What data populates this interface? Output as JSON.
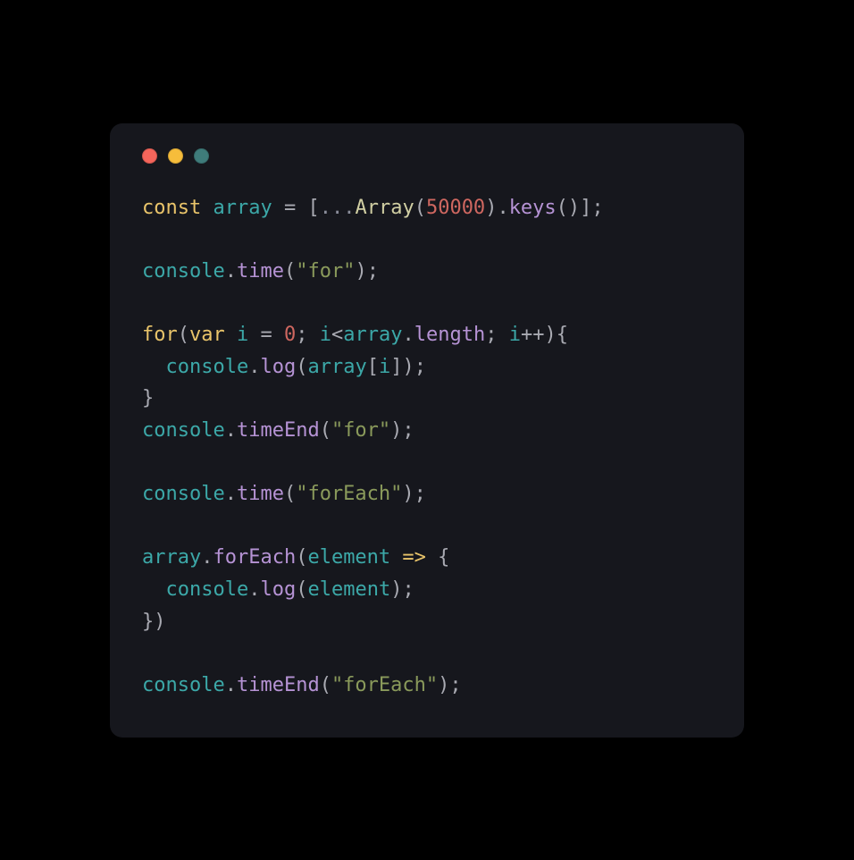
{
  "code": {
    "lines": [
      {
        "tokens": [
          {
            "cls": "c-kw",
            "t": "const"
          },
          {
            "cls": "",
            "t": " "
          },
          {
            "cls": "c-var",
            "t": "array"
          },
          {
            "cls": "",
            "t": " "
          },
          {
            "cls": "c-punct",
            "t": "="
          },
          {
            "cls": "",
            "t": " "
          },
          {
            "cls": "c-punct",
            "t": "["
          },
          {
            "cls": "c-spread",
            "t": "..."
          },
          {
            "cls": "c-global",
            "t": "Array"
          },
          {
            "cls": "c-punct",
            "t": "("
          },
          {
            "cls": "c-num",
            "t": "50000"
          },
          {
            "cls": "c-punct",
            "t": ")"
          },
          {
            "cls": "c-punct",
            "t": "."
          },
          {
            "cls": "c-func",
            "t": "keys"
          },
          {
            "cls": "c-punct",
            "t": "("
          },
          {
            "cls": "c-punct",
            "t": ")"
          },
          {
            "cls": "c-punct",
            "t": "]"
          },
          {
            "cls": "c-punct",
            "t": ";"
          }
        ]
      },
      {
        "tokens": []
      },
      {
        "tokens": [
          {
            "cls": "c-var",
            "t": "console"
          },
          {
            "cls": "c-punct",
            "t": "."
          },
          {
            "cls": "c-func",
            "t": "time"
          },
          {
            "cls": "c-punct",
            "t": "("
          },
          {
            "cls": "c-str",
            "t": "\"for\""
          },
          {
            "cls": "c-punct",
            "t": ")"
          },
          {
            "cls": "c-punct",
            "t": ";"
          }
        ]
      },
      {
        "tokens": []
      },
      {
        "tokens": [
          {
            "cls": "c-kw",
            "t": "for"
          },
          {
            "cls": "c-punct",
            "t": "("
          },
          {
            "cls": "c-kw",
            "t": "var"
          },
          {
            "cls": "",
            "t": " "
          },
          {
            "cls": "c-var",
            "t": "i"
          },
          {
            "cls": "",
            "t": " "
          },
          {
            "cls": "c-punct",
            "t": "="
          },
          {
            "cls": "",
            "t": " "
          },
          {
            "cls": "c-num",
            "t": "0"
          },
          {
            "cls": "c-punct",
            "t": ";"
          },
          {
            "cls": "",
            "t": " "
          },
          {
            "cls": "c-var",
            "t": "i"
          },
          {
            "cls": "c-punct",
            "t": "<"
          },
          {
            "cls": "c-var",
            "t": "array"
          },
          {
            "cls": "c-punct",
            "t": "."
          },
          {
            "cls": "c-func",
            "t": "length"
          },
          {
            "cls": "c-punct",
            "t": ";"
          },
          {
            "cls": "",
            "t": " "
          },
          {
            "cls": "c-var",
            "t": "i"
          },
          {
            "cls": "c-punct",
            "t": "++"
          },
          {
            "cls": "c-punct",
            "t": ")"
          },
          {
            "cls": "c-punct",
            "t": "{"
          }
        ]
      },
      {
        "indent": true,
        "tokens": [
          {
            "cls": "c-var",
            "t": "console"
          },
          {
            "cls": "c-punct",
            "t": "."
          },
          {
            "cls": "c-func",
            "t": "log"
          },
          {
            "cls": "c-punct",
            "t": "("
          },
          {
            "cls": "c-var",
            "t": "array"
          },
          {
            "cls": "c-punct",
            "t": "["
          },
          {
            "cls": "c-var",
            "t": "i"
          },
          {
            "cls": "c-punct",
            "t": "]"
          },
          {
            "cls": "c-punct",
            "t": ")"
          },
          {
            "cls": "c-punct",
            "t": ";"
          }
        ]
      },
      {
        "tokens": [
          {
            "cls": "c-punct",
            "t": "}"
          }
        ]
      },
      {
        "tokens": [
          {
            "cls": "c-var",
            "t": "console"
          },
          {
            "cls": "c-punct",
            "t": "."
          },
          {
            "cls": "c-func",
            "t": "timeEnd"
          },
          {
            "cls": "c-punct",
            "t": "("
          },
          {
            "cls": "c-str",
            "t": "\"for\""
          },
          {
            "cls": "c-punct",
            "t": ")"
          },
          {
            "cls": "c-punct",
            "t": ";"
          }
        ]
      },
      {
        "tokens": []
      },
      {
        "tokens": [
          {
            "cls": "c-var",
            "t": "console"
          },
          {
            "cls": "c-punct",
            "t": "."
          },
          {
            "cls": "c-func",
            "t": "time"
          },
          {
            "cls": "c-punct",
            "t": "("
          },
          {
            "cls": "c-str",
            "t": "\"forEach\""
          },
          {
            "cls": "c-punct",
            "t": ")"
          },
          {
            "cls": "c-punct",
            "t": ";"
          }
        ]
      },
      {
        "tokens": []
      },
      {
        "tokens": [
          {
            "cls": "c-var",
            "t": "array"
          },
          {
            "cls": "c-punct",
            "t": "."
          },
          {
            "cls": "c-func",
            "t": "forEach"
          },
          {
            "cls": "c-punct",
            "t": "("
          },
          {
            "cls": "c-var",
            "t": "element"
          },
          {
            "cls": "",
            "t": " "
          },
          {
            "cls": "c-arrow",
            "t": "=>"
          },
          {
            "cls": "",
            "t": " "
          },
          {
            "cls": "c-punct",
            "t": "{"
          }
        ]
      },
      {
        "indent": true,
        "tokens": [
          {
            "cls": "c-var",
            "t": "console"
          },
          {
            "cls": "c-punct",
            "t": "."
          },
          {
            "cls": "c-func",
            "t": "log"
          },
          {
            "cls": "c-punct",
            "t": "("
          },
          {
            "cls": "c-var",
            "t": "element"
          },
          {
            "cls": "c-punct",
            "t": ")"
          },
          {
            "cls": "c-punct",
            "t": ";"
          }
        ]
      },
      {
        "tokens": [
          {
            "cls": "c-punct",
            "t": "}"
          },
          {
            "cls": "c-punct",
            "t": ")"
          }
        ]
      },
      {
        "tokens": []
      },
      {
        "tokens": [
          {
            "cls": "c-var",
            "t": "console"
          },
          {
            "cls": "c-punct",
            "t": "."
          },
          {
            "cls": "c-func",
            "t": "timeEnd"
          },
          {
            "cls": "c-punct",
            "t": "("
          },
          {
            "cls": "c-str",
            "t": "\"forEach\""
          },
          {
            "cls": "c-punct",
            "t": ")"
          },
          {
            "cls": "c-punct",
            "t": ";"
          }
        ]
      }
    ]
  }
}
